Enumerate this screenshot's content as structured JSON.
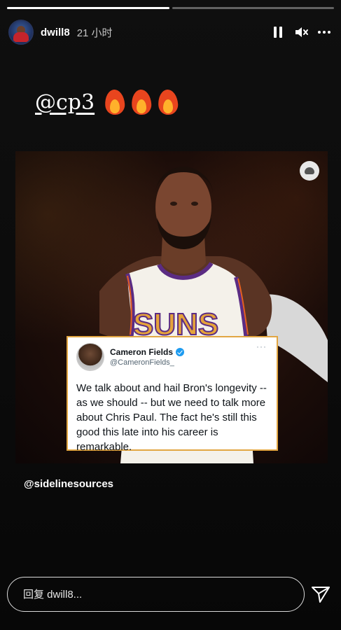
{
  "story": {
    "progress": [
      {
        "fill_percent": 100
      },
      {
        "fill_percent": 0
      },
      {
        "fill_percent": 0
      }
    ],
    "header": {
      "username": "dwill8",
      "time": "21 小时",
      "icons": [
        "pause-icon",
        "mute-icon",
        "more-icon"
      ]
    },
    "mention_sticker": {
      "text": "@cp3",
      "emoji": "🔥🔥🔥"
    },
    "tweet": {
      "name": "Cameron Fields",
      "handle": "@CameronFields_",
      "more": "···",
      "body": "We talk about and hail Bron's longevity -- as we should -- but we need to talk more about Chris Paul. The fact he's still this good this late into his career is remarkable."
    },
    "caption": "@sidelinesources",
    "reply": {
      "placeholder": "回复 dwill8..."
    },
    "colors": {
      "tweet_border": "#e2a642",
      "verified": "#1d9bf0",
      "jersey_purple": "#5b2c83",
      "jersey_orange": "#e56020"
    }
  }
}
